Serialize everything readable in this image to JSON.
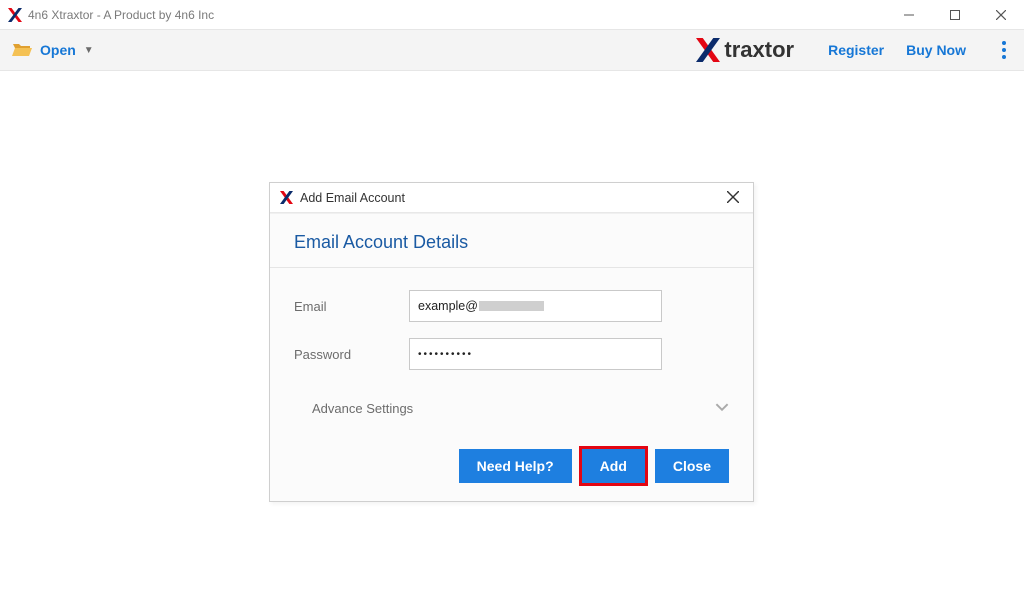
{
  "window": {
    "title": "4n6 Xtraxtor - A Product by 4n6 Inc"
  },
  "toolbar": {
    "open_label": "Open",
    "register_label": "Register",
    "buy_label": "Buy Now",
    "logo_text": "traxtor"
  },
  "dialog": {
    "title": "Add Email Account",
    "heading": "Email Account Details",
    "email_label": "Email",
    "email_value": "example@",
    "password_label": "Password",
    "password_value": "••••••••••",
    "advance_label": "Advance Settings",
    "buttons": {
      "help": "Need Help?",
      "add": "Add",
      "close": "Close"
    }
  }
}
